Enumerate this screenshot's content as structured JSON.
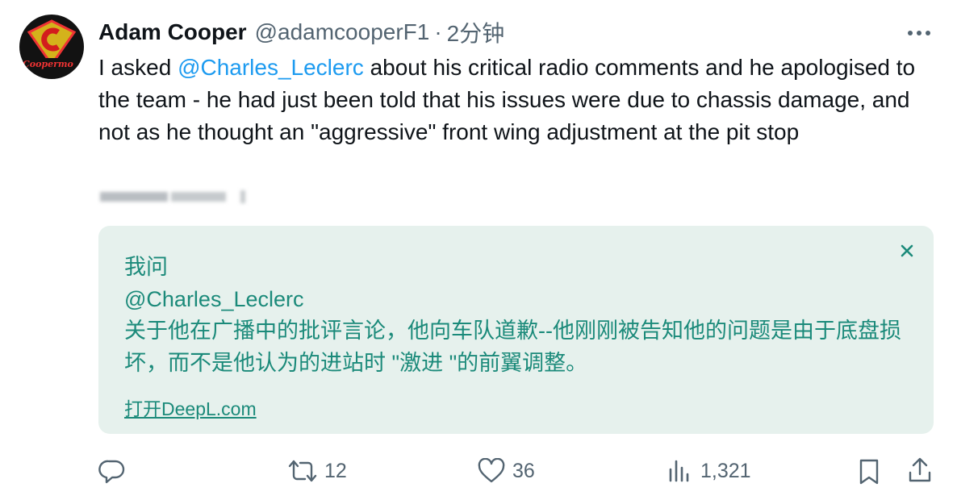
{
  "author": {
    "name": "Adam Cooper",
    "handle": "@adamcooperF1",
    "time": "2分钟",
    "avatar_text": "Coopermo"
  },
  "tweet": {
    "pre_mention": "I asked ",
    "mention": "@Charles_Leclerc",
    "post_mention": " about his critical radio comments and he apologised to the team - he had just been told that his issues were due to chassis damage, and not as he thought an \"aggressive\" front wing adjustment at the pit stop"
  },
  "translation": {
    "line1": "我问",
    "line2": "@Charles_Leclerc",
    "line3": "关于他在广播中的批评言论，他向车队道歉--他刚刚被告知他的问题是由于底盘损坏，而不是他认为的进站时 \"激进 \"的前翼调整。",
    "link": "打开DeepL.com",
    "close_icon": "close-icon"
  },
  "actions": {
    "reply_icon": "reply-icon",
    "retweet_icon": "retweet-icon",
    "retweet_count": "12",
    "like_icon": "heart-icon",
    "like_count": "36",
    "views_icon": "views-icon",
    "views_count": "1,321",
    "bookmark_icon": "bookmark-icon",
    "share_icon": "share-icon"
  },
  "colors": {
    "mention": "#1d9bf0",
    "translation_bg": "#e6f1ed",
    "translation_text": "#1b8a7a",
    "secondary": "#536471"
  }
}
